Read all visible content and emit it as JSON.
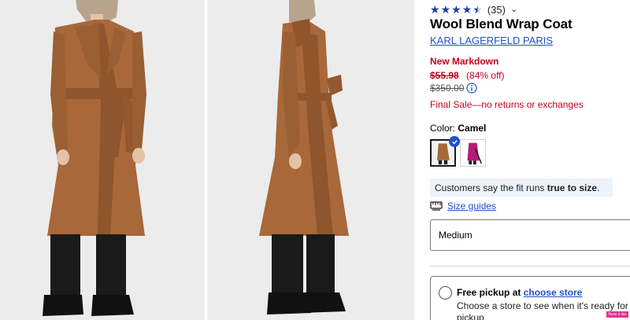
{
  "gallery": {
    "images": [
      {
        "icon": "coat-front-photo"
      },
      {
        "icon": "coat-side-photo"
      }
    ]
  },
  "product": {
    "rating": {
      "stars": 4.5,
      "max_stars": 5,
      "count": "(35)",
      "star_color": "#1c3fa6"
    },
    "title": "Wool Blend Wrap Coat",
    "brand": "KARL LAGERFELD PARIS",
    "markdown_label": "New Markdown",
    "sale_price": "$55.98",
    "percent_off": "(84% off)",
    "original_price": "$350.00",
    "final_sale_note": "Final Sale—no returns or exchanges",
    "sale_color": "#c4001f",
    "link_color": "#2150cc"
  },
  "color": {
    "label": "Color:",
    "selected": "Camel",
    "swatches": [
      {
        "name": "camel",
        "icon": "camel-coat-swatch",
        "selected": true,
        "hex": "#a8683a"
      },
      {
        "name": "magenta",
        "icon": "magenta-coat-swatch",
        "selected": false,
        "hex": "#b51a7a"
      }
    ]
  },
  "fit": {
    "text_prefix": "Customers say the fit runs ",
    "text_bold": "true to size",
    "text_suffix": "."
  },
  "size": {
    "guides_label": "Size guides",
    "selected_value": "Medium"
  },
  "pickup": {
    "title_prefix": "Free pickup at ",
    "store_link": "choose store",
    "description": "Choose a store to see when it's ready for pickup"
  },
  "overlay_badge": "Paste it like"
}
